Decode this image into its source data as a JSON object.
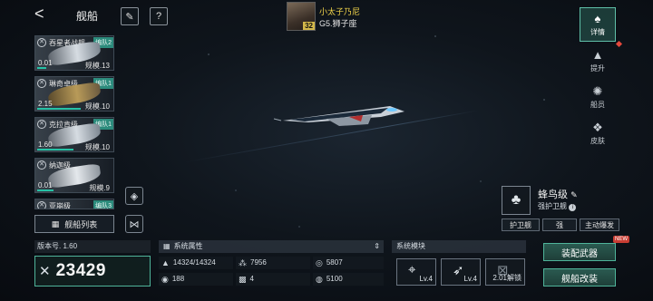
{
  "header": {
    "title": "舰船",
    "player": {
      "name": "小太子乃尼",
      "level": "32",
      "region": "G5.狮子座"
    }
  },
  "ship_list": [
    {
      "name": "吞星者战舰",
      "fleet": "编队2",
      "value": "0.01",
      "scale": "规模.13"
    },
    {
      "name": "琳奇卓级",
      "fleet": "编队1",
      "value": "2.15",
      "scale": "规模.10"
    },
    {
      "name": "克拉肯级",
      "fleet": "编队1",
      "value": "1.60",
      "scale": "规模.10"
    },
    {
      "name": "纳迦级",
      "fleet": "",
      "value": "0.01",
      "scale": "规模.9"
    },
    {
      "name": "亚崩级",
      "fleet": "编队3",
      "value": "",
      "scale": ""
    }
  ],
  "fleet_list_label": "舰船列表",
  "right_tabs": [
    {
      "label": "详情",
      "icon": "details-icon",
      "active": true
    },
    {
      "label": "提升",
      "icon": "upgrade-icon",
      "active": false
    },
    {
      "label": "船员",
      "icon": "crew-icon",
      "active": false
    },
    {
      "label": "皮肤",
      "icon": "skin-icon",
      "active": false
    }
  ],
  "ship_info": {
    "class_name": "蜂鸟级",
    "role": "强护卫舰",
    "tags": [
      "护卫舰",
      "强",
      "主动爆发"
    ]
  },
  "version": "版本号. 1.60",
  "power": "23429",
  "attributes": {
    "header": "系统属性",
    "items": [
      {
        "icon": "durability-icon",
        "value": "14324/14324"
      },
      {
        "icon": "fleet-icon",
        "value": "7956"
      },
      {
        "icon": "target-icon",
        "value": "5807"
      },
      {
        "icon": "speed-icon",
        "value": "188"
      },
      {
        "icon": "grid-icon",
        "value": "4"
      },
      {
        "icon": "shield-icon",
        "value": "5100"
      }
    ]
  },
  "modules": {
    "header": "系统模块",
    "slots": [
      {
        "icon": "crosshair-icon",
        "level": "Lv.4"
      },
      {
        "icon": "missile-icon",
        "level": "Lv.4"
      },
      {
        "icon": "locked-slot-icon",
        "level": "2.01解锁"
      }
    ]
  },
  "actions": {
    "equip_weapon": "装配武器",
    "refit_ship": "舰船改装",
    "new_badge": "NEW"
  },
  "colors": {
    "accent": "#4fb49a",
    "fleet_tag": "#2c8b7c",
    "player_name": "#f2d44a",
    "alert": "#e4483c"
  }
}
